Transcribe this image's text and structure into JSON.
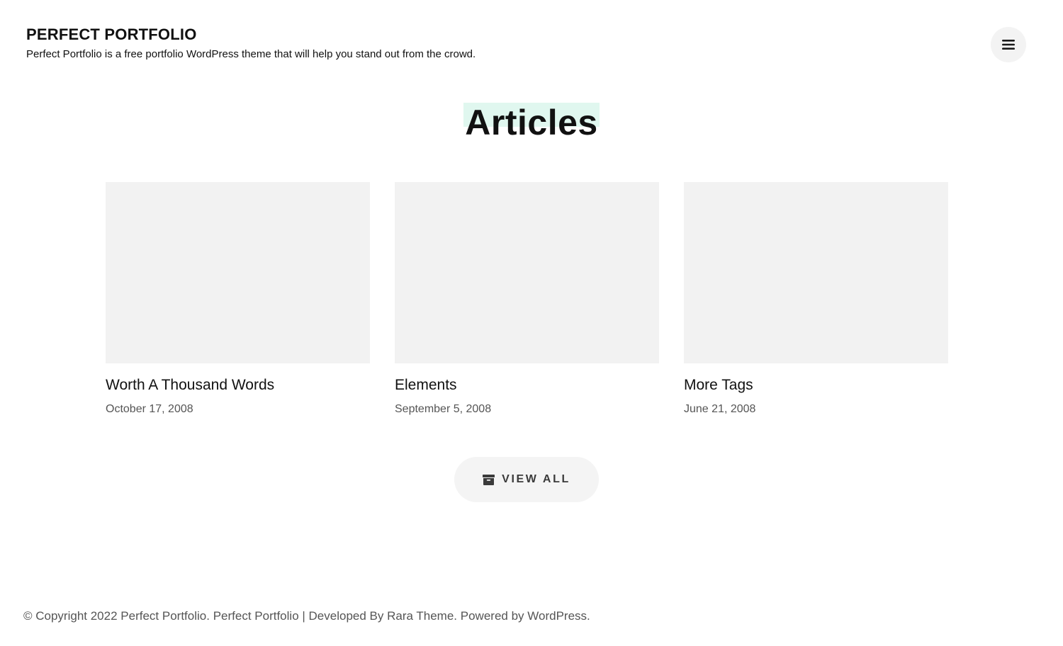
{
  "header": {
    "site_title": "PERFECT PORTFOLIO",
    "site_description": "Perfect Portfolio is a free portfolio WordPress theme that will help you stand out from the crowd.",
    "menu_icon": "hamburger-menu-icon"
  },
  "section": {
    "title": "Articles",
    "highlight_color": "#e0f7ef"
  },
  "articles": [
    {
      "title": "Worth A Thousand Words",
      "date": "October 17, 2008"
    },
    {
      "title": "Elements",
      "date": "September 5, 2008"
    },
    {
      "title": "More Tags",
      "date": "June 21, 2008"
    }
  ],
  "view_all": {
    "icon": "archive-icon",
    "label": "VIEW ALL"
  },
  "footer": {
    "copyright_prefix": "© Copyright 2022",
    "site_link": "Perfect Portfolio",
    "period_one": ".",
    "theme_name": "Perfect Portfolio",
    "developed_by_prefix": "| Developed By",
    "developer_link": "Rara Theme",
    "period_two": ".",
    "powered_by_prefix": "Powered by",
    "powered_by_link": "WordPress",
    "period_three": "."
  },
  "colors": {
    "background": "#ffffff",
    "text": "#111111",
    "muted_text": "#555555",
    "thumbnail_placeholder": "#f2f2f2",
    "button_background": "#f4f4f4"
  }
}
